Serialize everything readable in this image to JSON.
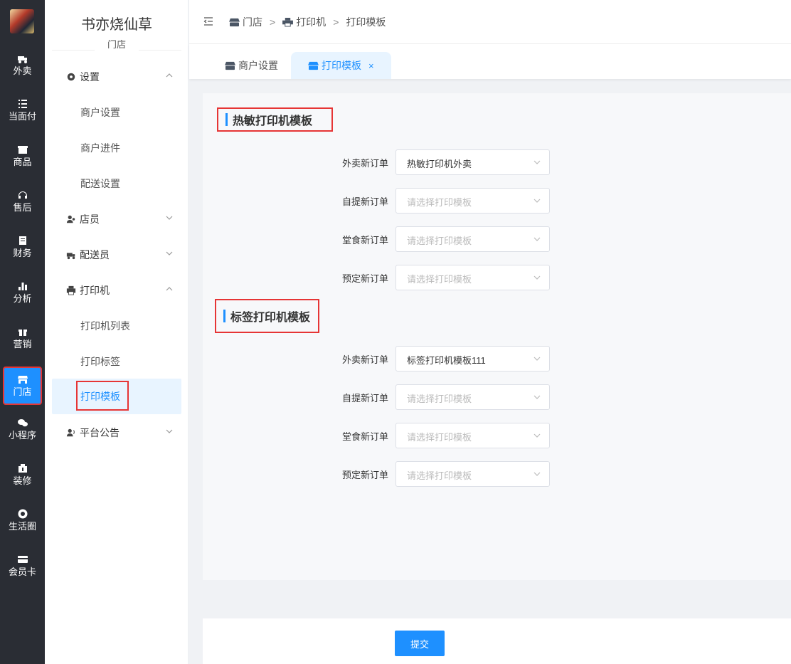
{
  "rail": {
    "items": [
      {
        "label": "外卖",
        "icon": "delivery-icon"
      },
      {
        "label": "当面付",
        "icon": "list-icon"
      },
      {
        "label": "商品",
        "icon": "product-icon"
      },
      {
        "label": "售后",
        "icon": "headset-icon"
      },
      {
        "label": "财务",
        "icon": "finance-icon"
      },
      {
        "label": "分析",
        "icon": "chart-icon"
      },
      {
        "label": "营销",
        "icon": "gift-icon"
      },
      {
        "label": "门店",
        "icon": "store-icon"
      },
      {
        "label": "小程序",
        "icon": "wechat-icon"
      },
      {
        "label": "装修",
        "icon": "decor-icon"
      },
      {
        "label": "生活圈",
        "icon": "circle-icon"
      },
      {
        "label": "会员卡",
        "icon": "card-icon"
      }
    ],
    "active_index": 7
  },
  "sidebar": {
    "shop_name": "书亦烧仙草",
    "section": "门店",
    "groups": {
      "settings": "设置",
      "staff": "店员",
      "courier": "配送员",
      "printer": "打印机",
      "notice": "平台公告"
    },
    "subs": {
      "merchant_settings": "商户设置",
      "merchant_onboarding": "商户进件",
      "delivery_settings": "配送设置",
      "printer_list": "打印机列表",
      "print_label": "打印标签",
      "print_template": "打印模板"
    }
  },
  "breadcrumb": {
    "store": "门店",
    "printer": "打印机",
    "template": "打印模板",
    "separator": ">"
  },
  "tabs": {
    "merchant_settings": "商户设置",
    "print_template": "打印模板",
    "close": "×"
  },
  "thermal": {
    "title": "热敏打印机模板",
    "rows": [
      {
        "label": "外卖新订单",
        "value": "热敏打印机外卖",
        "placeholder": false
      },
      {
        "label": "自提新订单",
        "value": "请选择打印模板",
        "placeholder": true
      },
      {
        "label": "堂食新订单",
        "value": "请选择打印模板",
        "placeholder": true
      },
      {
        "label": "预定新订单",
        "value": "请选择打印模板",
        "placeholder": true
      }
    ]
  },
  "label_printer": {
    "title": "标签打印机模板",
    "rows": [
      {
        "label": "外卖新订单",
        "value": "标签打印机模板111",
        "placeholder": false
      },
      {
        "label": "自提新订单",
        "value": "请选择打印模板",
        "placeholder": true
      },
      {
        "label": "堂食新订单",
        "value": "请选择打印模板",
        "placeholder": true
      },
      {
        "label": "预定新订单",
        "value": "请选择打印模板",
        "placeholder": true
      }
    ]
  },
  "footer": {
    "submit_label": "提交"
  },
  "colors": {
    "accent": "#1e90ff",
    "highlight": "#e63535",
    "rail": "#2a2d34"
  }
}
